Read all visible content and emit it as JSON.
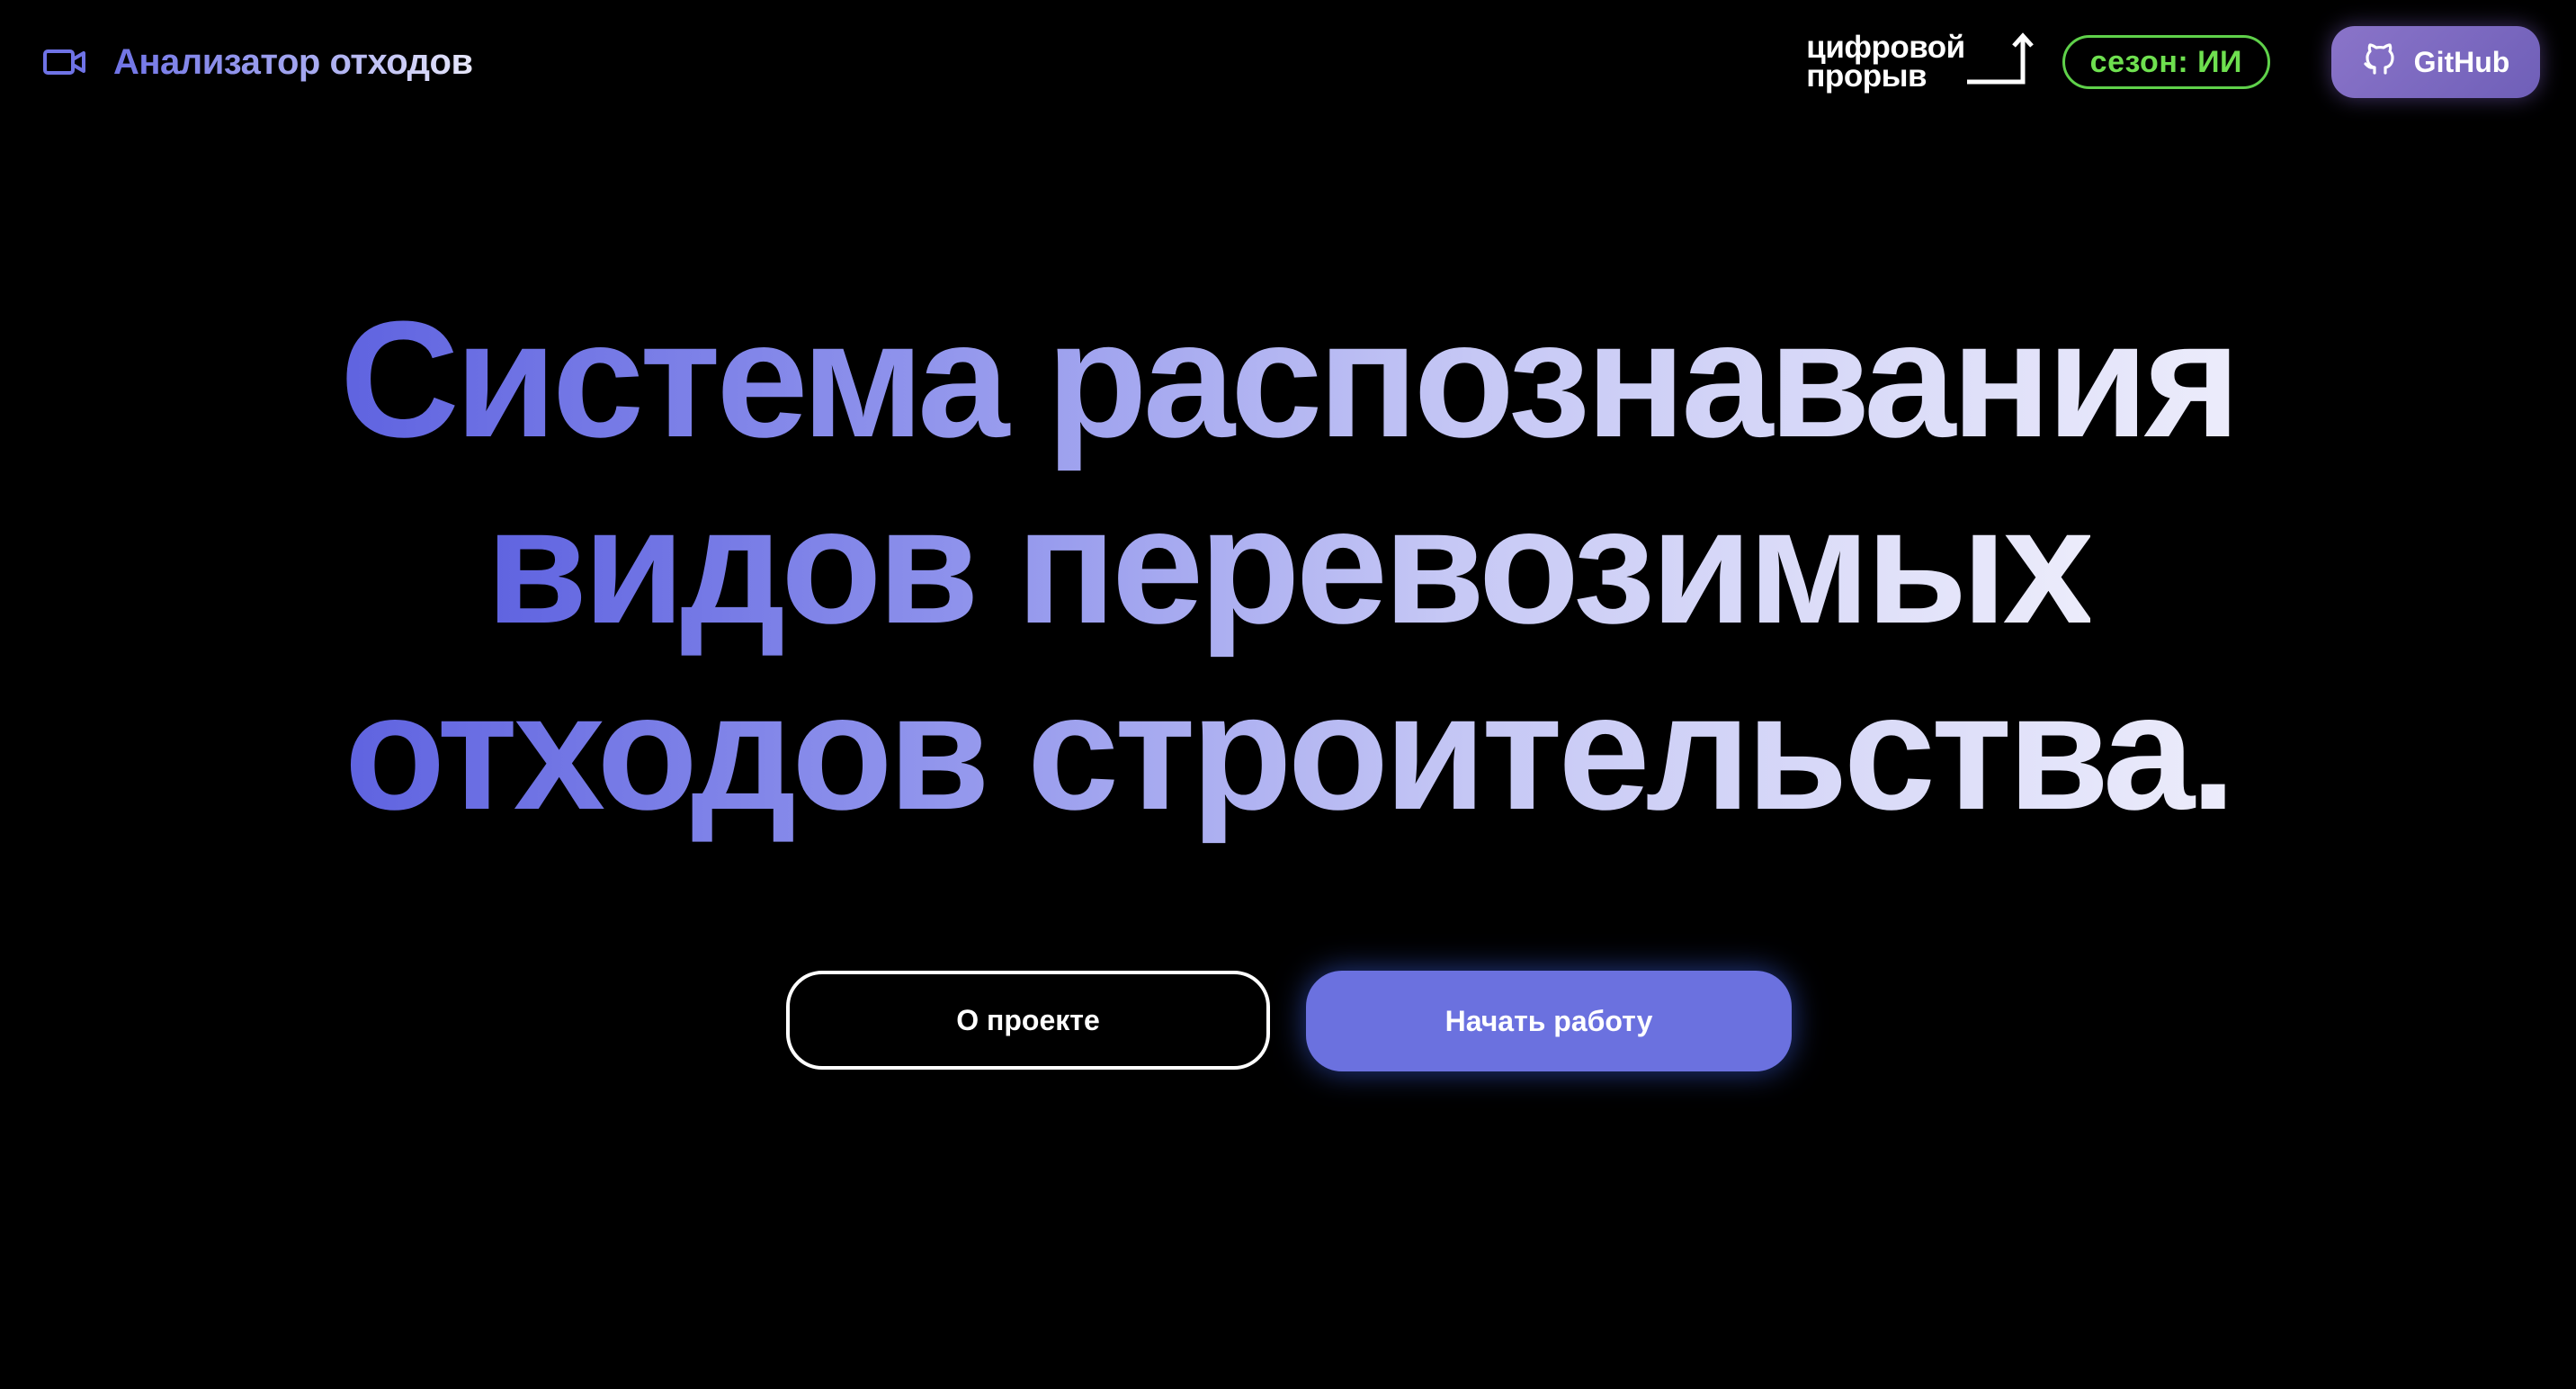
{
  "header": {
    "brand": {
      "icon": "video-camera-icon",
      "title": "Анализатор отходов",
      "accent_color": "#6f73e6"
    },
    "partner_logo": {
      "line1": "цифровой",
      "line2": "прорыв",
      "icon": "arrow-up-icon"
    },
    "season_badge": {
      "label": "сезон: ИИ",
      "color": "#5fd14a"
    },
    "github_button": {
      "label": "GitHub",
      "icon": "github-icon",
      "color": "#7d68c2"
    }
  },
  "hero": {
    "lines": [
      "Система распознавания",
      "видов перевозимых",
      "отходов строительства."
    ],
    "gradient": [
      "#5f63e0",
      "#ececfb"
    ]
  },
  "actions": {
    "about_label": "О проекте",
    "start_label": "Начать работу",
    "primary_color": "#6b71df"
  }
}
